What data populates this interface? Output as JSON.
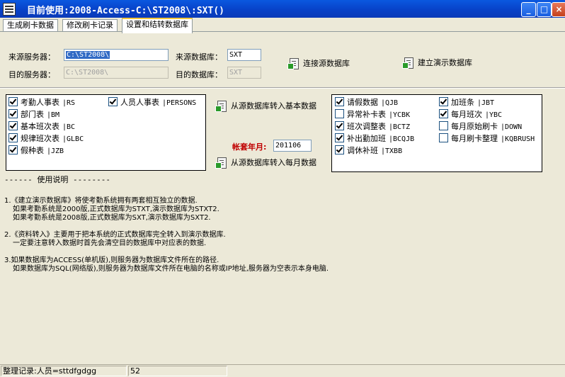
{
  "window": {
    "title": "目前使用:2008-Access-C:\\ST2008\\:SXT()",
    "minimize": "_",
    "maximize": "□",
    "close": "×"
  },
  "tabs": [
    "生成刷卡数据",
    "修改刷卡记录",
    "设置和结转数据库"
  ],
  "form": {
    "src_server_label": "来源服务器：",
    "src_server_value": "C:\\ST2008\\",
    "dst_server_label": "目的服务器：",
    "dst_server_value": "C:\\ST2008\\",
    "src_db_label": "来源数据库：",
    "src_db_value": "SXT",
    "dst_db_label": "目的数据库：",
    "dst_db_value": "SXT",
    "connect_label": "连接源数据库",
    "create_demo_label": "建立演示数据库",
    "transfer_basic_label": "从源数据库转入基本数据",
    "transfer_monthly_label": "从源数据库转入每月数据",
    "period_label": "帐套年月:",
    "period_value": "201106"
  },
  "basic_tables": [
    {
      "name": "考勤人事表",
      "code": "|RS",
      "checked": true
    },
    {
      "name": "人员人事表",
      "code": "|PERSONS",
      "checked": true
    },
    {
      "name": "部门表",
      "code": "|BM",
      "checked": true
    },
    {
      "name": "基本班次表",
      "code": "|BC",
      "checked": true
    },
    {
      "name": "规律班次表",
      "code": "|GLBC",
      "checked": true
    },
    {
      "name": "假种表",
      "code": "|JZB",
      "checked": true
    }
  ],
  "monthly_tables": [
    {
      "name": "请假数据",
      "code": "|QJB",
      "checked": true
    },
    {
      "name": "加班条",
      "code": "|JBT",
      "checked": true
    },
    {
      "name": "异常补卡表",
      "code": "|YCBK",
      "checked": false
    },
    {
      "name": "每月班次",
      "code": "|YBC",
      "checked": true
    },
    {
      "name": "班次调整表",
      "code": "|BCTZ",
      "checked": true
    },
    {
      "name": "每月原始刷卡",
      "code": "|DOWN",
      "checked": false
    },
    {
      "name": "补出勤加班",
      "code": "|BCQJB",
      "checked": true
    },
    {
      "name": "每月刷卡整理",
      "code": "|KQBRUSH",
      "checked": false
    },
    {
      "name": "调休补班",
      "code": "|TXBB",
      "checked": true
    }
  ],
  "usage": {
    "header": "------ 使用说明 --------",
    "lines": [
      "1.《建立演示数据库》将使考勤系统拥有两套相互独立的数据.",
      "如果考勤系统是2000版,正式数据库为STXT,演示数据库为STXT2.",
      "如果考勤系统是2008版,正式数据库为SXT,演示数据库为SXT2.",
      "2.《资料转入》主要用于把本系统的正式数据库完全转入到演示数据库.",
      "一定要注意转入数据时首先会清空目的数据库中对应表的数据.",
      "3.如果数据库为ACCESS(单机版),则服务器为数据库文件所在的路径.",
      "如果数据库为SQL(网络版),则服务器为数据库文件所在电脑的名称或IP地址,服务器为空表示本身电脑."
    ]
  },
  "status": {
    "record": "整理记录:人员=sttdfgdgg",
    "count": "52"
  }
}
